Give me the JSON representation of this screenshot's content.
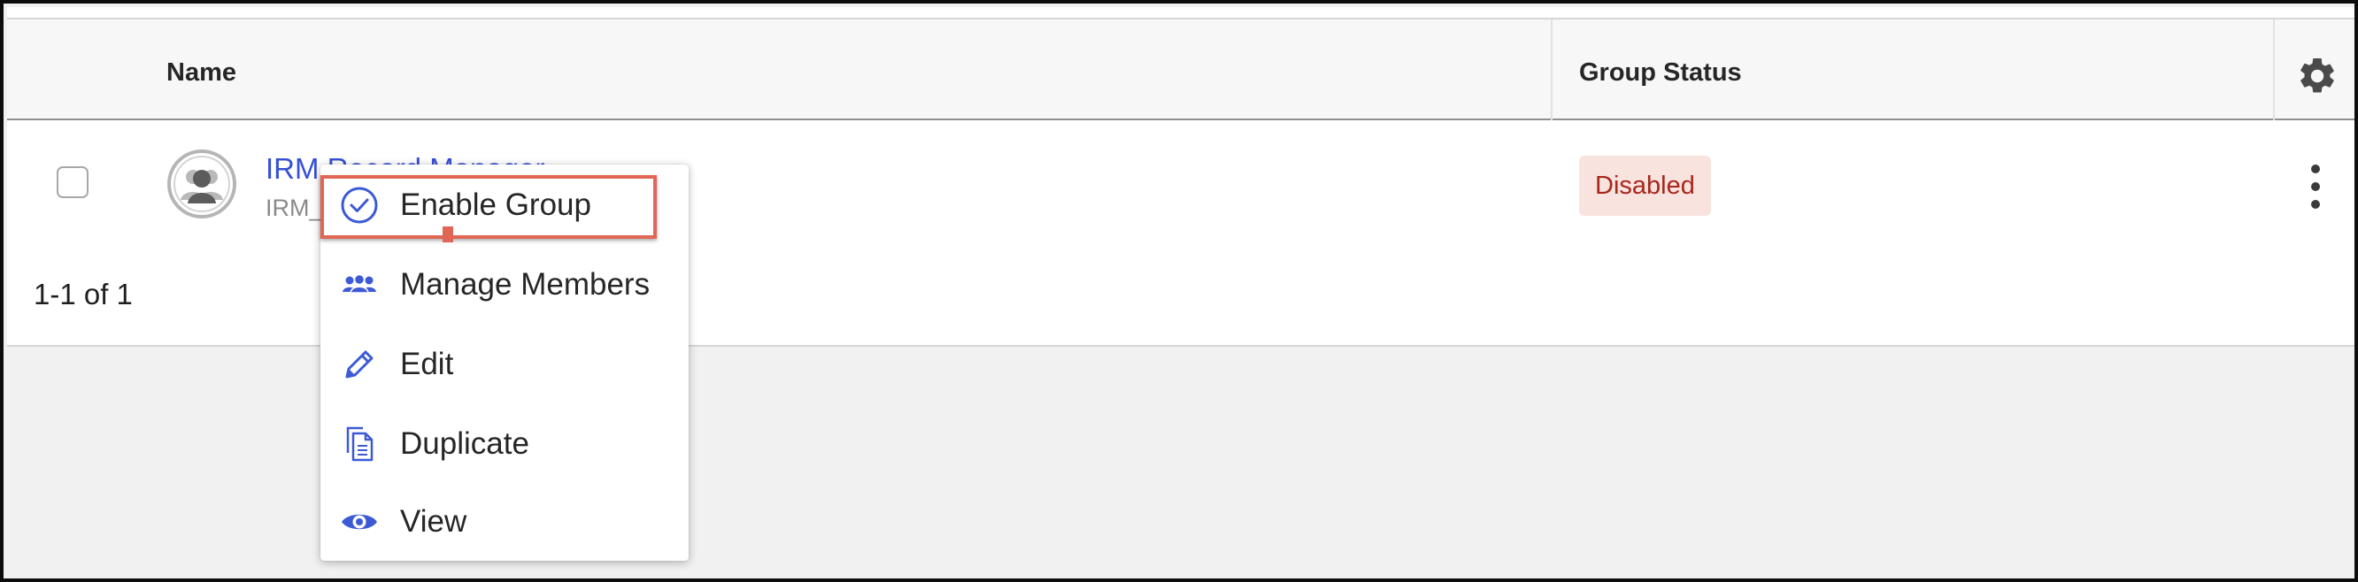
{
  "table": {
    "columns": {
      "name": "Name",
      "status": "Group Status"
    },
    "rows": [
      {
        "name": "IRM Record Manager",
        "subtitle": "IRM_",
        "status": "Disabled"
      }
    ]
  },
  "pagination": {
    "text": "1-1 of 1"
  },
  "context_menu": {
    "items": [
      {
        "label": "Enable Group",
        "icon": "check-circle-icon"
      },
      {
        "label": "Manage Members",
        "icon": "users-icon"
      },
      {
        "label": "Edit",
        "icon": "pencil-icon"
      },
      {
        "label": "Duplicate",
        "icon": "duplicate-icon"
      },
      {
        "label": "View",
        "icon": "eye-icon"
      }
    ]
  },
  "colors": {
    "link": "#3650d6",
    "icon_blue": "#3c5ad6",
    "badge_bg": "#f9e3df",
    "badge_text": "#a8261b",
    "highlight": "#e06655"
  }
}
